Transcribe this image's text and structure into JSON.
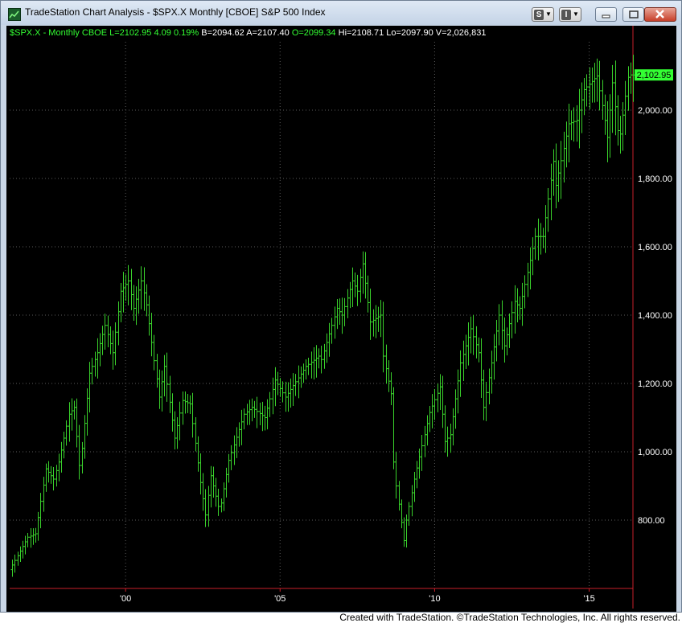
{
  "window": {
    "title": "TradeStation Chart Analysis - $SPX.X Monthly [CBOE] S&P 500 Index",
    "toolbar": [
      {
        "label": "S",
        "icon": "s-menu-icon"
      },
      {
        "label": "I",
        "icon": "i-menu-icon"
      }
    ]
  },
  "status": {
    "symbol": "$SPX.X - Monthly  CBOE",
    "last": "L=2102.95",
    "change": "4.09",
    "change_pct": "0.19%",
    "bid": "B=2094.62",
    "ask": "A=2107.40",
    "open": "O=2099.34",
    "high": "Hi=2108.71",
    "low": "Lo=2097.90",
    "volume": "V=2,026,831"
  },
  "footer": "Created with TradeStation. ©TradeStation Technologies, Inc. All rights reserved.",
  "colors": {
    "bar": "#39d12b",
    "background": "#000000",
    "grid": "#5a5a5a",
    "axis_line": "#c8202a",
    "last_price_tag": "#33ff33"
  },
  "chart_data": {
    "type": "ohlc",
    "title": "$SPX.X Monthly [CBOE] S&P 500 Index",
    "x_ticks": [
      "'00",
      "'05",
      "'10",
      "'15"
    ],
    "x_tick_years": [
      2000,
      2005,
      2010,
      2015
    ],
    "y_ticks": [
      "800.00",
      "1,000.00",
      "1,200.00",
      "1,400.00",
      "1,600.00",
      "1,800.00",
      "2,000.00"
    ],
    "y_tick_values": [
      800,
      1000,
      1200,
      1400,
      1600,
      1800,
      2000
    ],
    "ylim": [
      600,
      2200
    ],
    "xlim": [
      "1996-04",
      "2016-06"
    ],
    "last_price_label": "2,102.95",
    "last_price": 2102.95,
    "grid": true,
    "anchors": [
      [
        "1996-05",
        655
      ],
      [
        "1996-12",
        750
      ],
      [
        "1997-03",
        760
      ],
      [
        "1997-07",
        950
      ],
      [
        "1997-10",
        920
      ],
      [
        "1997-12",
        970
      ],
      [
        "1998-04",
        1110
      ],
      [
        "1998-06",
        1130
      ],
      [
        "1998-08",
        960
      ],
      [
        "1998-09",
        1010
      ],
      [
        "1998-12",
        1230
      ],
      [
        "1999-03",
        1290
      ],
      [
        "1999-06",
        1370
      ],
      [
        "1999-09",
        1290
      ],
      [
        "1999-12",
        1470
      ],
      [
        "2000-03",
        1500
      ],
      [
        "2000-05",
        1420
      ],
      [
        "2000-08",
        1500
      ],
      [
        "2000-10",
        1430
      ],
      [
        "2000-12",
        1320
      ],
      [
        "2001-03",
        1160
      ],
      [
        "2001-05",
        1250
      ],
      [
        "2001-09",
        1040
      ],
      [
        "2001-12",
        1150
      ],
      [
        "2002-03",
        1140
      ],
      [
        "2002-07",
        910
      ],
      [
        "2002-09",
        815
      ],
      [
        "2002-11",
        930
      ],
      [
        "2003-02",
        840
      ],
      [
        "2003-03",
        850
      ],
      [
        "2003-06",
        975
      ],
      [
        "2003-12",
        1110
      ],
      [
        "2004-03",
        1130
      ],
      [
        "2004-08",
        1100
      ],
      [
        "2004-12",
        1210
      ],
      [
        "2005-04",
        1160
      ],
      [
        "2005-12",
        1250
      ],
      [
        "2006-05",
        1280
      ],
      [
        "2006-06",
        1270
      ],
      [
        "2006-12",
        1420
      ],
      [
        "2007-02",
        1400
      ],
      [
        "2007-06",
        1500
      ],
      [
        "2007-08",
        1470
      ],
      [
        "2007-10",
        1550
      ],
      [
        "2008-01",
        1380
      ],
      [
        "2008-05",
        1400
      ],
      [
        "2008-06",
        1280
      ],
      [
        "2008-09",
        1170
      ],
      [
        "2008-10",
        970
      ],
      [
        "2008-11",
        900
      ],
      [
        "2009-02",
        740
      ],
      [
        "2009-03",
        800
      ],
      [
        "2009-06",
        920
      ],
      [
        "2009-12",
        1115
      ],
      [
        "2010-04",
        1190
      ],
      [
        "2010-06",
        1030
      ],
      [
        "2010-08",
        1050
      ],
      [
        "2010-12",
        1260
      ],
      [
        "2011-04",
        1360
      ],
      [
        "2011-07",
        1290
      ],
      [
        "2011-09",
        1130
      ],
      [
        "2011-12",
        1260
      ],
      [
        "2012-03",
        1400
      ],
      [
        "2012-05",
        1310
      ],
      [
        "2012-09",
        1440
      ],
      [
        "2012-11",
        1420
      ],
      [
        "2013-05",
        1630
      ],
      [
        "2013-08",
        1630
      ],
      [
        "2013-12",
        1850
      ],
      [
        "2014-01",
        1780
      ],
      [
        "2014-06",
        1960
      ],
      [
        "2014-09",
        1970
      ],
      [
        "2014-12",
        2060
      ],
      [
        "2015-05",
        2100
      ],
      [
        "2015-08",
        1970
      ],
      [
        "2015-09",
        1920
      ],
      [
        "2015-11",
        2080
      ],
      [
        "2016-01",
        1940
      ],
      [
        "2016-02",
        1930
      ],
      [
        "2016-05",
        2096
      ],
      [
        "2016-06",
        2103
      ]
    ],
    "note_series": "Monthly OHLC bars"
  }
}
